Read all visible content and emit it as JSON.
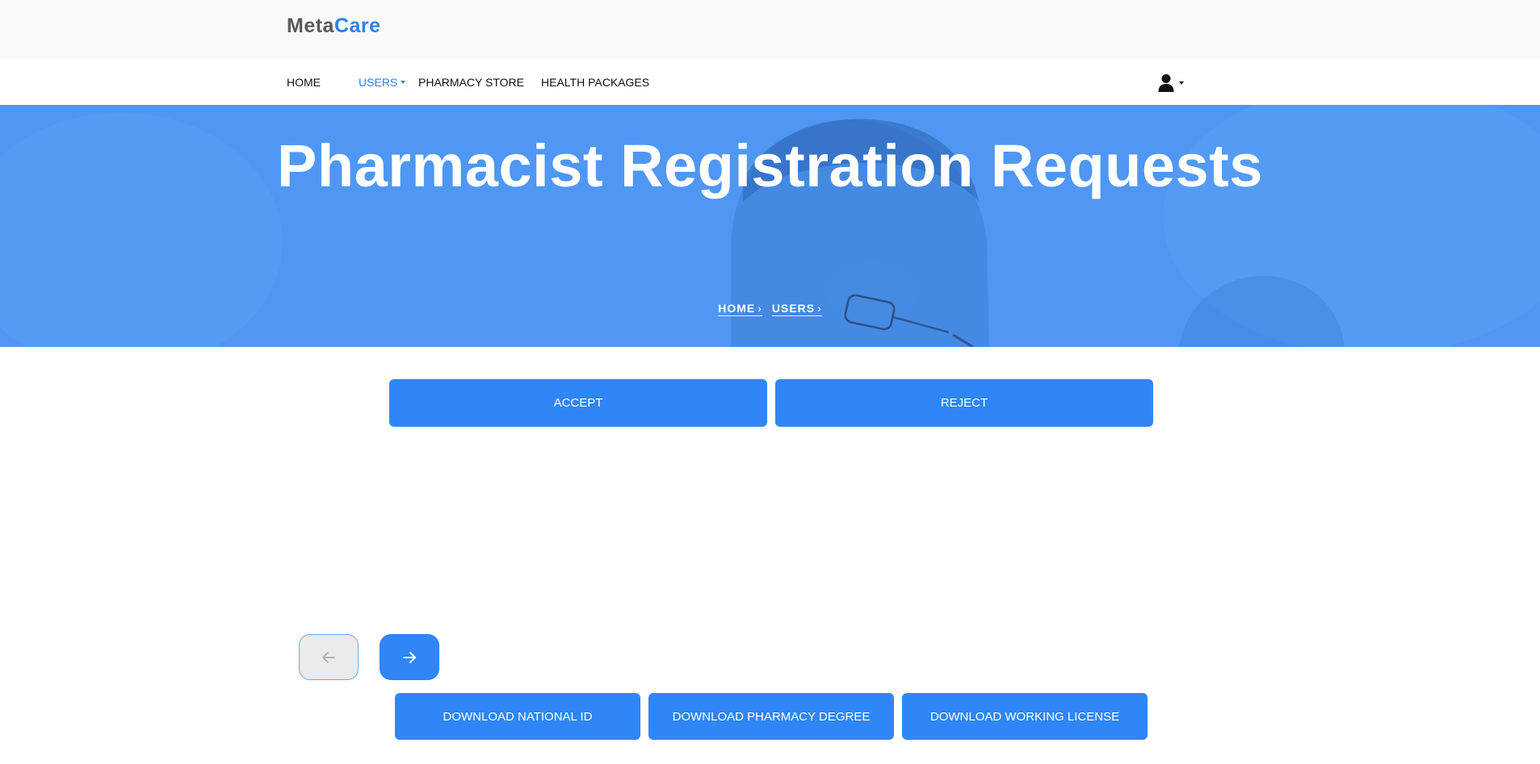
{
  "brand": {
    "name_part1": "Meta",
    "name_part2": "Care"
  },
  "nav": {
    "items": [
      {
        "label": "HOME",
        "active": false
      },
      {
        "label": "USERS",
        "active": true,
        "has_dropdown": true
      },
      {
        "label": "PHARMACY STORE",
        "active": false
      },
      {
        "label": "HEALTH PACKAGES",
        "active": false
      }
    ],
    "user_menu": {
      "icon": "user-icon",
      "has_dropdown": true
    }
  },
  "hero": {
    "title": "Pharmacist Registration Requests",
    "breadcrumb": [
      "HOME",
      "USERS"
    ],
    "background_color": "#4f97f3"
  },
  "actions": {
    "accept_label": "ACCEPT",
    "reject_label": "REJECT"
  },
  "carousel": {
    "prev_icon": "arrow-left-icon",
    "next_icon": "arrow-right-icon",
    "prev_disabled": true
  },
  "downloads": {
    "national_id_label": "DOWNLOAD NATIONAL ID",
    "pharmacy_degree_label": "DOWNLOAD PHARMACY DEGREE",
    "working_license_label": "DOWNLOAD WORKING LICENSE"
  },
  "colors": {
    "accent": "#2f86f6",
    "brand_blue": "#2f80ed",
    "brand_gray": "#5a5a5a"
  }
}
